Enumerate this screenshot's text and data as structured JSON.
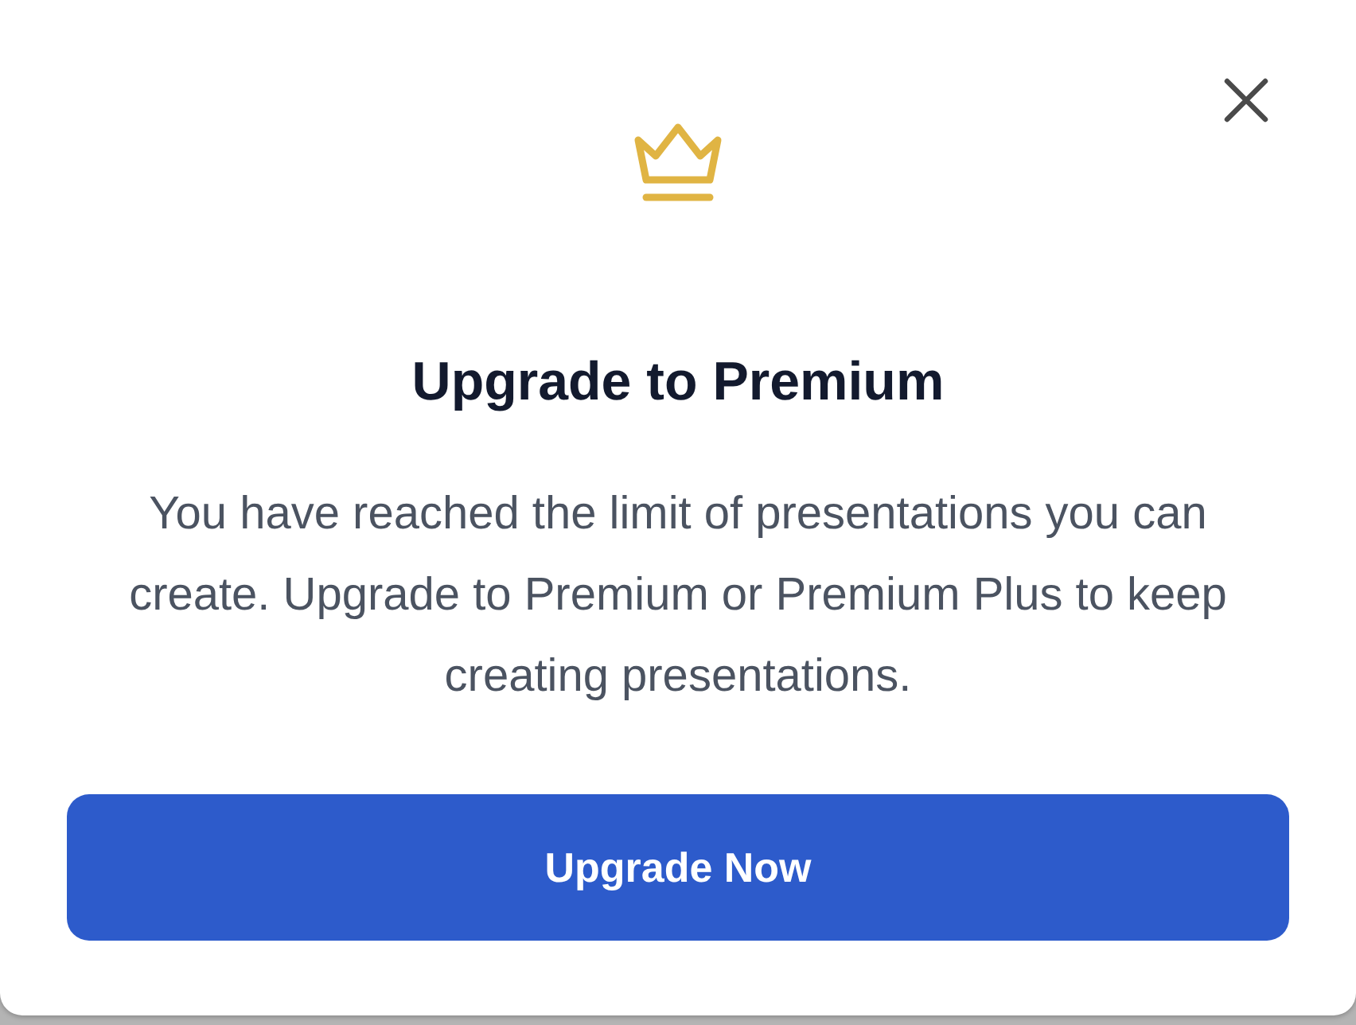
{
  "dialog": {
    "title": "Upgrade to Premium",
    "message": "You have reached the limit of presentations you can create. Upgrade to Premium or Premium Plus to keep creating presentations.",
    "primary_button": "Upgrade Now"
  }
}
